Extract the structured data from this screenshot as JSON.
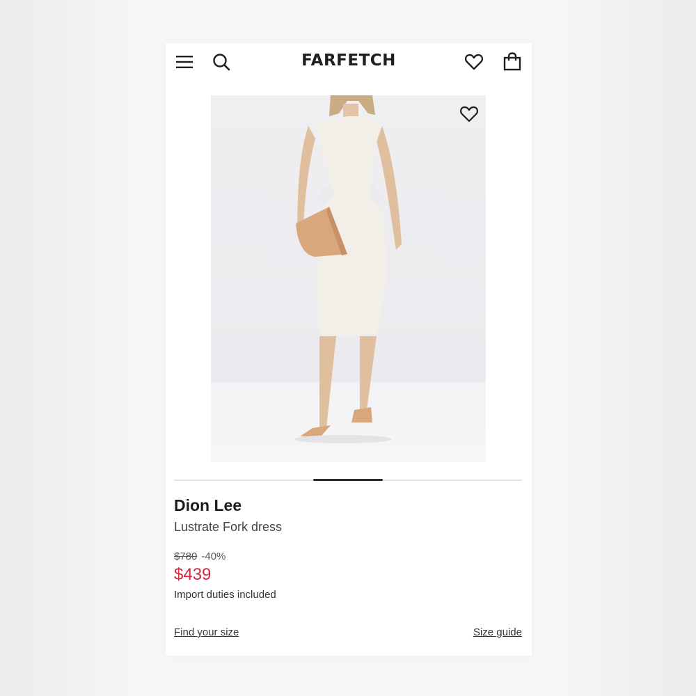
{
  "header": {
    "logo": "FARFETCH",
    "menu_icon": "menu-icon",
    "search_icon": "search-icon",
    "wishlist_icon": "heart-icon",
    "bag_icon": "shopping-bag-icon"
  },
  "product": {
    "image_icon": "dress-photo",
    "wishlist_icon": "heart-icon",
    "brand": "Dion Lee",
    "name": "Lustrate Fork dress",
    "original_price": "$780",
    "discount": "-40%",
    "sale_price": "$439",
    "duties_note": "Import duties included",
    "carousel_position": 0.5
  },
  "links": {
    "find_size": "Find your size",
    "size_guide": "Size guide"
  },
  "colors": {
    "sale": "#d4283f",
    "text": "#1a1a1a",
    "background": "#ffffff"
  }
}
